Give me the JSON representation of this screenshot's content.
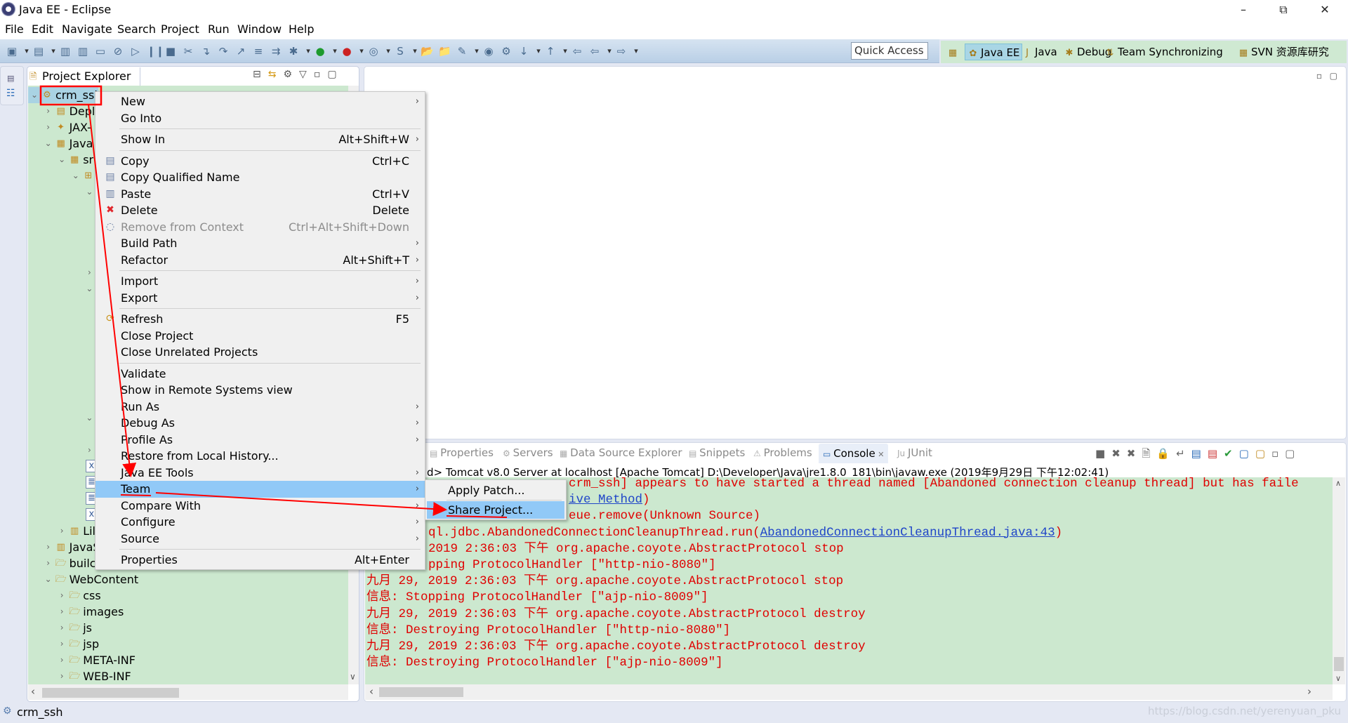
{
  "window": {
    "title": "Java EE - Eclipse",
    "controls": [
      "minimize",
      "restore",
      "close"
    ]
  },
  "menubar": [
    "File",
    "Edit",
    "Navigate",
    "Search",
    "Project",
    "Run",
    "Window",
    "Help"
  ],
  "toolbar": {
    "icons": [
      "new-icon",
      "dropdown-icon",
      "new-wizard-icon",
      "dropdown-icon",
      "save-icon",
      "save-all-icon",
      "console-icon",
      "skip-breakpoints-icon",
      "resume-icon",
      "suspend-icon",
      "terminate-icon",
      "disconnect-icon",
      "step-into-icon",
      "step-over-icon",
      "step-return-icon",
      "drop-to-frame-icon",
      "use-step-filters-icon",
      "debug-icon",
      "dropdown-icon",
      "run-icon",
      "dropdown-icon",
      "run-server-icon",
      "dropdown-icon",
      "new-server-icon",
      "dropdown-icon",
      "new-snippet-icon",
      "dropdown-icon",
      "open-type-icon",
      "open-folder-icon",
      "search-icon",
      "dropdown-icon",
      "globe-icon",
      "ant-icon",
      "next-annotation-icon",
      "dropdown-icon",
      "prev-annotation-icon",
      "dropdown-icon",
      "last-edit-icon",
      "back-icon",
      "dropdown-icon",
      "forward-icon",
      "dropdown-icon"
    ],
    "quick_access": "Quick Access"
  },
  "perspectives": [
    {
      "label": "Java EE",
      "icon": "java-ee-icon",
      "active": true
    },
    {
      "label": "Java",
      "icon": "java-icon",
      "active": false
    },
    {
      "label": "Debug",
      "icon": "bug-icon",
      "active": false
    },
    {
      "label": "Team Synchronizing",
      "icon": "sync-icon",
      "active": false
    },
    {
      "label": "SVN 资源库研究",
      "icon": "svn-icon",
      "active": false
    }
  ],
  "project_explorer": {
    "tab_label": "Project Explorer",
    "rows": [
      {
        "label": "crm_ssl",
        "level": 0,
        "toggle": "expanded",
        "icon": "project-icon",
        "selected": true
      },
      {
        "label": "Depl",
        "level": 1,
        "toggle": "collapsed",
        "icon": "deployment-icon"
      },
      {
        "label": "JAX-",
        "level": 1,
        "toggle": "collapsed",
        "icon": "jax-ws-icon"
      },
      {
        "label": "Java",
        "level": 1,
        "toggle": "expanded",
        "icon": "java-resources-icon"
      },
      {
        "label": "sr",
        "level": 2,
        "toggle": "expanded",
        "icon": "source-folder-icon"
      },
      {
        "label": "",
        "level": 3,
        "toggle": "expanded",
        "icon": "package-icon"
      },
      {
        "label": "",
        "level": 4,
        "toggle": "expanded",
        "icon": ""
      },
      {},
      {},
      {},
      {},
      {
        "label": "",
        "level": 4,
        "toggle": "collapsed",
        "icon": ""
      },
      {
        "label": "",
        "level": 4,
        "toggle": "expanded",
        "icon": ""
      },
      {},
      {},
      {},
      {},
      {},
      {},
      {},
      {
        "label": "",
        "level": 4,
        "toggle": "expanded",
        "icon": ""
      },
      {},
      {
        "label": "",
        "level": 4,
        "toggle": "collapsed",
        "icon": ""
      },
      {
        "label": "",
        "level": 4,
        "toggle": "none",
        "icon": "xml-file-icon"
      },
      {
        "label": "",
        "level": 4,
        "toggle": "none",
        "icon": "text-file-icon"
      },
      {
        "label": "",
        "level": 4,
        "toggle": "none",
        "icon": "text-file-icon"
      },
      {
        "label": "",
        "level": 4,
        "toggle": "none",
        "icon": "xml-file-icon"
      },
      {
        "label": "Lil",
        "level": 2,
        "toggle": "collapsed",
        "icon": "library-icon"
      },
      {
        "label": "JavaS",
        "level": 1,
        "toggle": "collapsed",
        "icon": "library-icon"
      },
      {
        "label": "builc",
        "level": 1,
        "toggle": "collapsed",
        "icon": "folder-icon"
      },
      {
        "label": "WebContent",
        "level": 1,
        "toggle": "expanded",
        "icon": "folder-icon"
      },
      {
        "label": "css",
        "level": 2,
        "toggle": "collapsed",
        "icon": "folder-icon"
      },
      {
        "label": "images",
        "level": 2,
        "toggle": "collapsed",
        "icon": "folder-icon"
      },
      {
        "label": "js",
        "level": 2,
        "toggle": "collapsed",
        "icon": "folder-icon"
      },
      {
        "label": "jsp",
        "level": 2,
        "toggle": "collapsed",
        "icon": "folder-icon"
      },
      {
        "label": "META-INF",
        "level": 2,
        "toggle": "collapsed",
        "icon": "folder-icon"
      },
      {
        "label": "WEB-INF",
        "level": 2,
        "toggle": "collapsed",
        "icon": "folder-icon"
      }
    ]
  },
  "context_menu": [
    {
      "label": "New",
      "submenu": true
    },
    {
      "label": "Go Into",
      "sep_after": true
    },
    {
      "label": "Show In",
      "shortcut": "Alt+Shift+W",
      "submenu": true,
      "sep_after": true
    },
    {
      "label": "Copy",
      "shortcut": "Ctrl+C",
      "icon": "copy-icon"
    },
    {
      "label": "Copy Qualified Name",
      "icon": "copy-qualified-icon"
    },
    {
      "label": "Paste",
      "shortcut": "Ctrl+V",
      "icon": "paste-icon"
    },
    {
      "label": "Delete",
      "shortcut": "Delete",
      "icon": "delete-icon"
    },
    {
      "label": "Remove from Context",
      "shortcut": "Ctrl+Alt+Shift+Down",
      "icon": "remove-context-icon",
      "disabled": true
    },
    {
      "label": "Build Path",
      "submenu": true
    },
    {
      "label": "Refactor",
      "shortcut": "Alt+Shift+T",
      "submenu": true,
      "sep_after": true
    },
    {
      "label": "Import",
      "submenu": true
    },
    {
      "label": "Export",
      "submenu": true,
      "sep_after": true
    },
    {
      "label": "Refresh",
      "shortcut": "F5",
      "icon": "refresh-icon"
    },
    {
      "label": "Close Project"
    },
    {
      "label": "Close Unrelated Projects",
      "sep_after": true
    },
    {
      "label": "Validate"
    },
    {
      "label": "Show in Remote Systems view"
    },
    {
      "label": "Run As",
      "submenu": true
    },
    {
      "label": "Debug As",
      "submenu": true
    },
    {
      "label": "Profile As",
      "submenu": true
    },
    {
      "label": "Restore from Local History..."
    },
    {
      "label": "Java EE Tools",
      "submenu": true
    },
    {
      "label": "Team",
      "submenu": true,
      "highlighted": true
    },
    {
      "label": "Compare With",
      "submenu": true
    },
    {
      "label": "Configure",
      "submenu": true
    },
    {
      "label": "Source",
      "submenu": true,
      "sep_after": true
    },
    {
      "label": "Properties",
      "shortcut": "Alt+Enter"
    }
  ],
  "team_submenu": [
    {
      "label": "Apply Patch..."
    },
    {
      "label": "Share Project...",
      "highlighted": true
    }
  ],
  "console": {
    "tabs": [
      {
        "label": "Properties",
        "icon": "properties-icon"
      },
      {
        "label": "Servers",
        "icon": "servers-icon"
      },
      {
        "label": "Data Source Explorer",
        "icon": "data-source-icon"
      },
      {
        "label": "Snippets",
        "icon": "snippets-icon"
      },
      {
        "label": "Problems",
        "icon": "problems-icon"
      },
      {
        "label": "Console",
        "icon": "console-icon",
        "active": true
      },
      {
        "label": "JUnit",
        "icon": "junit-icon"
      }
    ],
    "header": "d> Tomcat v8.0 Server at localhost [Apache Tomcat] D:\\Developer\\Java\\jre1.8.0_181\\bin\\javaw.exe (2019年9月29日 下午12:02:41)",
    "lines": [
      {
        "text": "crm_ssh] appears to have started a thread named [Abandoned connection cleanup thread] but has faile"
      },
      {
        "text": "",
        "link": "ive Method",
        "after": ")"
      },
      {
        "text": "eue.remove(Unknown Source)"
      },
      {
        "text": "ql.jdbc.AbandonedConnectionCleanupThread.run(",
        "link": "AbandonedConnectionCleanupThread.java:43",
        "after": ")"
      },
      {
        "text": "2019 2:36:03 下午 org.apache.coyote.AbstractProtocol stop"
      },
      {
        "text": "pping ProtocolHandler [\"http-nio-8080\"]"
      },
      {
        "text": "九月 29, 2019 2:36:03 下午 org.apache.coyote.AbstractProtocol stop"
      },
      {
        "text": "信息: Stopping ProtocolHandler [\"ajp-nio-8009\"]"
      },
      {
        "text": "九月 29, 2019 2:36:03 下午 org.apache.coyote.AbstractProtocol destroy"
      },
      {
        "text": "信息: Destroying ProtocolHandler [\"http-nio-8080\"]"
      },
      {
        "text": "九月 29, 2019 2:36:03 下午 org.apache.coyote.AbstractProtocol destroy"
      },
      {
        "text": "信息: Destroying ProtocolHandler [\"ajp-nio-8009\"]"
      }
    ]
  },
  "statusbar": {
    "text": "crm_ssh"
  },
  "watermark": "https://blog.csdn.net/yerenyuan_pku",
  "colors": {
    "tree_bg": "#cce8cf",
    "console_text": "#e00000",
    "link": "#1f45c8",
    "menu_highlight": "#91c9f7",
    "annotation": "#ff0000"
  }
}
